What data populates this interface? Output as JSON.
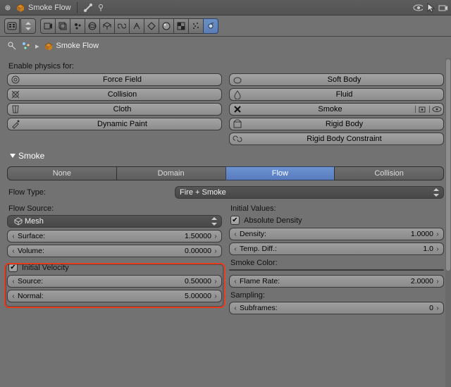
{
  "titlebar": {
    "object_name": "Smoke Flow"
  },
  "breadcrumb": {
    "object": "Smoke Flow"
  },
  "physics": {
    "label": "Enable physics for:",
    "left": [
      "Force Field",
      "Collision",
      "Cloth",
      "Dynamic Paint"
    ],
    "right": [
      "Soft Body",
      "Fluid",
      "Smoke",
      "Rigid Body",
      "Rigid Body Constraint"
    ]
  },
  "panel": {
    "title": "Smoke",
    "tabs": [
      "None",
      "Domain",
      "Flow",
      "Collision"
    ],
    "active_tab": "Flow",
    "flow_type_label": "Flow Type:",
    "flow_type_value": "Fire + Smoke",
    "flow_source_label": "Flow Source:",
    "flow_source_value": "Mesh",
    "surface": {
      "label": "Surface:",
      "value": "1.50000"
    },
    "volume": {
      "label": "Volume:",
      "value": "0.00000"
    },
    "init_vel": {
      "label": "Initial Velocity",
      "checked": true
    },
    "source": {
      "label": "Source:",
      "value": "0.50000"
    },
    "normal": {
      "label": "Normal:",
      "value": "5.00000"
    },
    "init_vals_label": "Initial Values:",
    "abs_density": {
      "label": "Absolute Density",
      "checked": true
    },
    "density": {
      "label": "Density:",
      "value": "1.0000"
    },
    "temp_diff": {
      "label": "Temp. Diff.:",
      "value": "1.0"
    },
    "smoke_color_label": "Smoke Color:",
    "flame_rate": {
      "label": "Flame Rate:",
      "value": "2.0000"
    },
    "sampling_label": "Sampling:",
    "subframes": {
      "label": "Subframes:",
      "value": "0"
    }
  }
}
